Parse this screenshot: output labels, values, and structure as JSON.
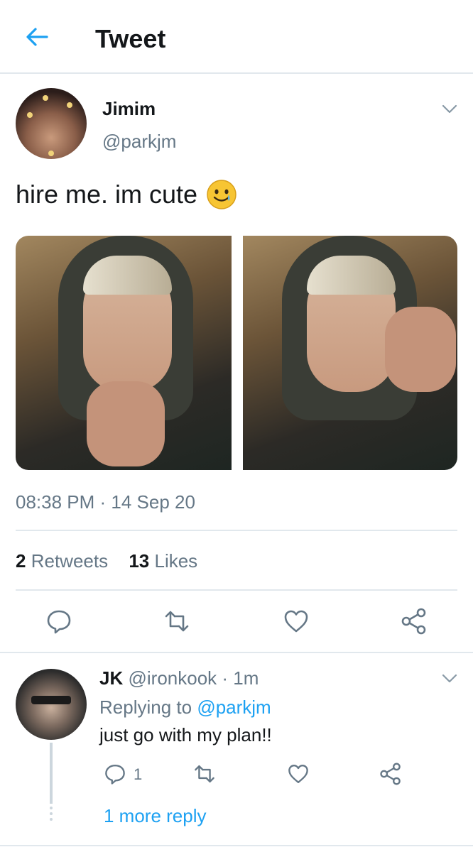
{
  "header": {
    "title": "Tweet",
    "back_icon": "back-arrow-icon"
  },
  "tweet": {
    "author_name": "Jimim",
    "author_handle": "@parkjm",
    "text": "hire me. im cute",
    "emoji": "smiling-face-with-tear",
    "timestamp": "08:38 PM · 14 Sep 20",
    "retweets_count": "2",
    "retweets_label": "Retweets",
    "likes_count": "13",
    "likes_label": "Likes",
    "photos": [
      "photo-1",
      "photo-2"
    ],
    "actions": [
      "reply-icon",
      "retweet-icon",
      "like-icon",
      "share-icon"
    ]
  },
  "reply": {
    "author_name": "JK",
    "author_handle": "@ironkook",
    "age": "· 1m",
    "replying_to_label": "Replying to",
    "replying_to_handle": "@parkjm",
    "text": "just go with my plan!!",
    "reply_count": "1",
    "more_replies": "1 more reply"
  },
  "colors": {
    "accent": "#1da1f2",
    "secondary_text": "#657786",
    "divider": "#e1e8ed"
  }
}
